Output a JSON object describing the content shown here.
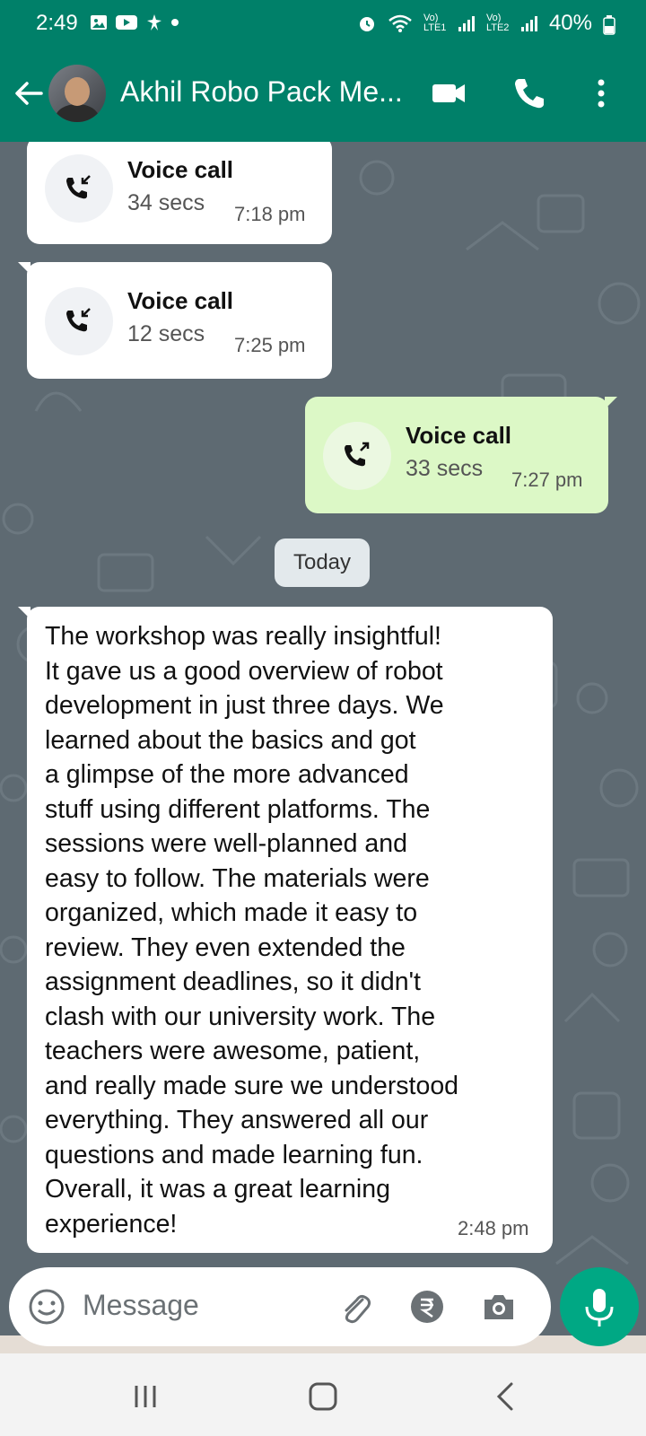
{
  "status_bar": {
    "time": "2:49",
    "battery": "40%",
    "sim1_label": "Vo) LTE1",
    "sim2_label": "Vo) LTE2"
  },
  "header": {
    "contact_name": "Akhil Robo Pack Me...",
    "accent_color": "#008069",
    "icons": [
      "back-arrow-icon",
      "avatar",
      "video-call-icon",
      "phone-icon",
      "more-options-icon"
    ]
  },
  "messages": [
    {
      "type": "call",
      "direction": "incoming",
      "title": "Voice call",
      "duration": "34 secs",
      "time": "7:18 pm"
    },
    {
      "type": "call",
      "direction": "incoming",
      "title": "Voice call",
      "duration": "12 secs",
      "time": "7:25 pm"
    },
    {
      "type": "call",
      "direction": "outgoing",
      "title": "Voice call",
      "duration": "33 secs",
      "time": "7:27 pm"
    }
  ],
  "date_separator": "Today",
  "text_message": {
    "direction": "incoming",
    "text": "The  workshop was really insightful!\nIt gave us a good overview of robot\ndevelopment in just three days. We\nlearned about the basics and got\na glimpse of the more advanced\nstuff using different platforms. The\nsessions were well-planned and\neasy to follow. The materials were\norganized, which made it easy to\nreview. They even extended the\nassignment deadlines, so it didn't\nclash with our university work. The\nteachers were awesome, patient,\nand really made sure we understood\neverything. They answered all our\nquestions and made learning fun.\nOverall, it was a great learning\nexperience!",
    "time": "2:48 pm"
  },
  "composer": {
    "placeholder": "Message",
    "icons": [
      "emoji-icon",
      "attach-icon",
      "rupee-payment-icon",
      "camera-icon",
      "mic-icon"
    ],
    "mic_color": "#00a884"
  },
  "nav_bar": {
    "icons": [
      "recent-apps-icon",
      "home-icon",
      "back-icon"
    ]
  }
}
